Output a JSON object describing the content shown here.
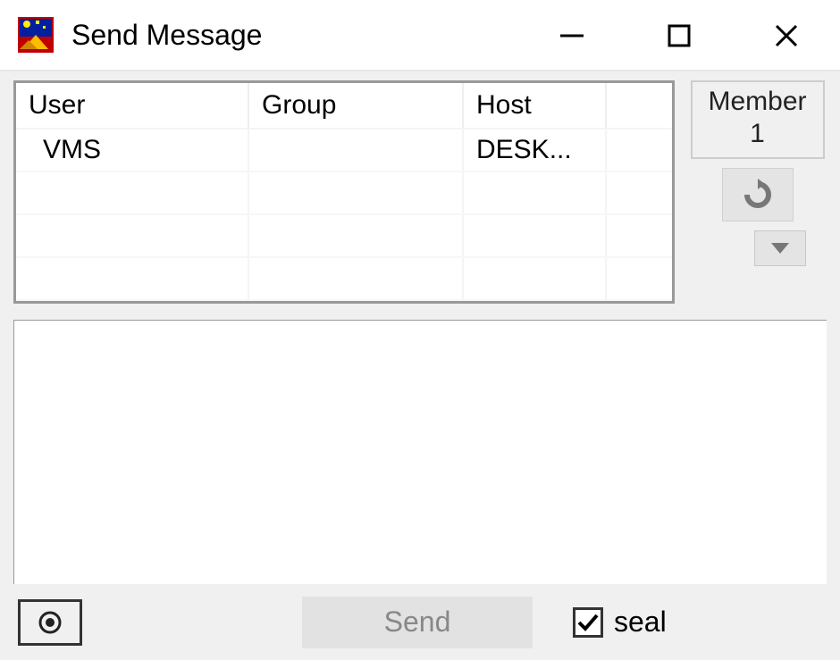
{
  "window": {
    "title": "Send Message"
  },
  "table": {
    "headers": [
      "User",
      "Group",
      "Host"
    ],
    "rows": [
      {
        "user": "VMS",
        "group": "",
        "host": "DESK..."
      }
    ]
  },
  "side": {
    "member_label": "Member",
    "member_count": "1"
  },
  "message": {
    "value": ""
  },
  "bottom": {
    "send_label": "Send",
    "seal_label": "seal",
    "seal_checked": true
  }
}
